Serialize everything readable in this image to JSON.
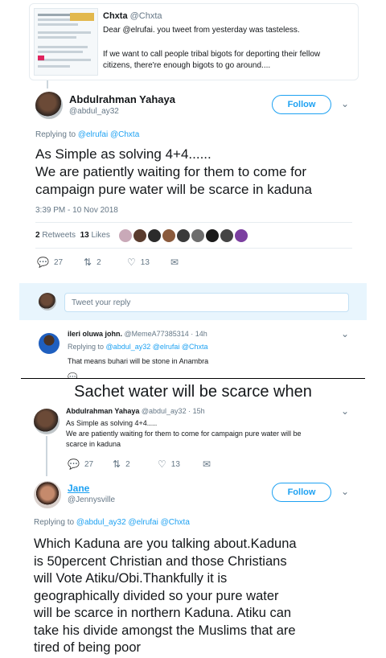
{
  "quoted_tweet": {
    "name": "Chxta",
    "handle": "@Chxta",
    "line1": "Dear @elrufai. you tweet from yesterday was tasteless.",
    "line2": "If we want to call people tribal bigots for deporting their fellow",
    "line3": "citizens, there're enough bigots to go around...."
  },
  "main_tweet": {
    "name": "Abdulrahman Yahaya",
    "handle": "@abdul_ay32",
    "follow_label": "Follow",
    "replying_label": "Replying to",
    "replying_to": "@elrufai @Chxta",
    "text_line1": "As Simple as solving 4+4......",
    "text_line2": "We are patiently waiting for them to come for",
    "text_line3": "campaign pure water will be scarce in kaduna",
    "timestamp": "3:39 PM - 10 Nov 2018",
    "retweets_count": "2",
    "retweets_label": "Retweets",
    "likes_count": "13",
    "likes_label": "Likes",
    "actions": {
      "replies": "27",
      "retweets": "2",
      "likes": "13"
    }
  },
  "reply_box": {
    "placeholder": "Tweet your reply"
  },
  "reply_ileri": {
    "name": "ileri oluwa john.",
    "handle_time": "@MemeA77385314 · 14h",
    "replying_label": "Replying to",
    "replying_to": "@abdul_ay32 @elrufai @Chxta",
    "text": "That means buhari will be stone in Anambra"
  },
  "caption": "Sachet water will be scarce when",
  "embedded_tweet": {
    "name": "Abdulrahman Yahaya",
    "handle_time": "@abdul_ay32 · 15h",
    "line1": "As Simple as solving 4+4.....",
    "line2": "We are patiently waiting for them to come for campaign pure water will be",
    "line3": "scarce in kaduna",
    "actions": {
      "replies": "27",
      "retweets": "2",
      "likes": "13"
    }
  },
  "jane_tweet": {
    "name": "Jane",
    "handle": "@Jennysville",
    "follow_label": "Follow",
    "replying_label": "Replying to",
    "replying_to": "@abdul_ay32 @elrufai @Chxta",
    "lines": [
      "Which Kaduna are you talking about.Kaduna",
      "is 50percent Christian and those Christians",
      "will  Vote Atiku/Obi.Thankfully it is",
      "geographically  divided so your pure water",
      "will be scarce in northern Kaduna. Atiku can",
      "take his divide  amongst the Muslims that are",
      "tired of being poor"
    ]
  },
  "colors": {
    "accent": "#1da1f2",
    "muted": "#657786",
    "border": "#e6ecf0"
  }
}
